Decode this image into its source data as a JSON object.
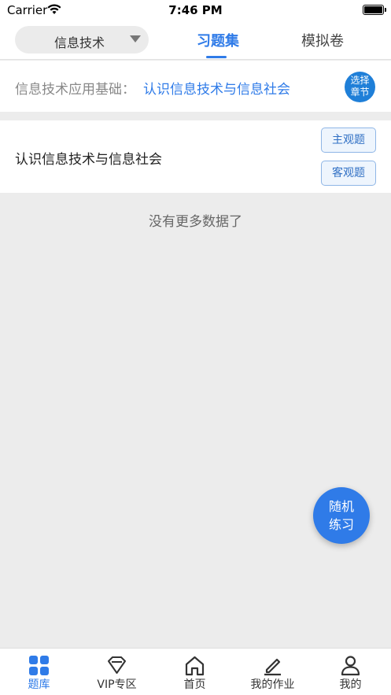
{
  "status_bar": {
    "carrier": "Carrier",
    "time": "7:46 PM"
  },
  "header": {
    "subject": "信息技术",
    "tabs": [
      {
        "label": "习题集",
        "active": true
      },
      {
        "label": "模拟卷",
        "active": false
      }
    ]
  },
  "chapter": {
    "prefix": "信息技术应用基础：",
    "name": "认识信息技术与信息社会",
    "choose_line1": "选择",
    "choose_line2": "章节"
  },
  "section": {
    "title": "认识信息技术与信息社会",
    "subjective_label": "主观题",
    "objective_label": "客观题"
  },
  "empty_message": "没有更多数据了",
  "random_practice": {
    "line1": "随机",
    "line2": "练习"
  },
  "bottom_nav": [
    {
      "label": "题库",
      "icon": "grid-icon",
      "active": true
    },
    {
      "label": "VIP专区",
      "icon": "diamond-icon",
      "active": false
    },
    {
      "label": "首页",
      "icon": "home-icon",
      "active": false
    },
    {
      "label": "我的作业",
      "icon": "edit-icon",
      "active": false
    },
    {
      "label": "我的",
      "icon": "user-icon",
      "active": false
    }
  ],
  "colors": {
    "accent": "#2f7be8",
    "background": "#ececec",
    "chapter_badge": "#1f7fd8"
  }
}
